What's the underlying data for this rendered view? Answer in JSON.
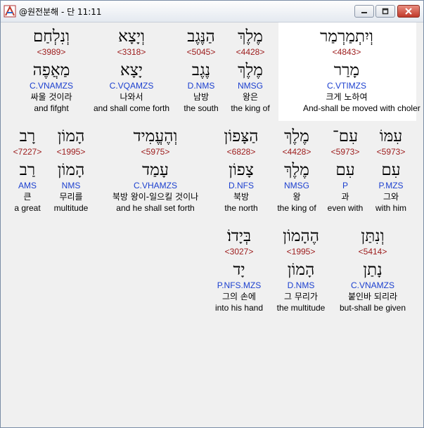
{
  "window": {
    "title": "@원전분해 - 단 11:11"
  },
  "rows": [
    [
      {
        "word": "וְיִתְמַרְמַר",
        "strong": "<4843>",
        "root": "מָרַר",
        "parse": "C.VTIMZS",
        "korean": "크게 노하여",
        "english": "And-shall be moved with choler",
        "highlight": true
      },
      {
        "word": "מֶלֶךְ",
        "strong": "<4428>",
        "root": "מֶלֶךְ",
        "parse": "NMSG",
        "korean": "왕은",
        "english": "the king of"
      },
      {
        "word": "הַנֶּגֶב",
        "strong": "<5045>",
        "root": "נֶגֶב",
        "parse": "D.NMS",
        "korean": "남방",
        "english": "the south"
      },
      {
        "word": "וְיָצָא",
        "strong": "<3318>",
        "root": "יָצָא",
        "parse": "C.VQAMZS",
        "korean": "나와서",
        "english": "and shall come forth"
      },
      {
        "word": "וְנִלְחַם",
        "strong": "<3989>",
        "root": "מַאֲפֶה",
        "parse": "C.VNAMZS",
        "korean": "싸울 것이라",
        "english": "and fifght"
      }
    ],
    [
      {
        "word": "עִמּוֹ",
        "strong": "<5973>",
        "root": "עִם",
        "parse": "P.MZS",
        "korean": "그와",
        "english": "with him"
      },
      {
        "word": "עִם־",
        "strong": "<5973>",
        "root": "עִם",
        "parse": "P",
        "korean": "과",
        "english": "even with"
      },
      {
        "word": "מֶלֶךְ",
        "strong": "<4428>",
        "root": "מֶלֶךְ",
        "parse": "NMSG",
        "korean": "왕",
        "english": "the king of"
      },
      {
        "word": "הַצָּפוֹן",
        "strong": "<6828>",
        "root": "צָפוֹן",
        "parse": "D.NFS",
        "korean": "북방",
        "english": "the north"
      },
      {
        "word": "וְהֶעֱמִיד",
        "strong": "<5975>",
        "root": "עָמַד",
        "parse": "C.VHAMZS",
        "korean": "북방 왕이-일으킬 것이나",
        "english": "and he shall set forth"
      },
      {
        "word": "הָמוֹן",
        "strong": "<1995>",
        "root": "הָמוֹן",
        "parse": "NMS",
        "korean": "무리를",
        "english": "multitude"
      },
      {
        "word": "רָב",
        "strong": "<7227>",
        "root": "רַב",
        "parse": "AMS",
        "korean": "큰",
        "english": "a great"
      }
    ],
    [
      {
        "word": "וְנִתַּן",
        "strong": "<5414>",
        "root": "נָתַן",
        "parse": "C.VNAMZS",
        "korean": "붙인바 되리라",
        "english": "but-shall be given"
      },
      {
        "word": "הֶהָמוֹן",
        "strong": "<1995>",
        "root": "הָמוֹן",
        "parse": "D.NMS",
        "korean": "그 무리가",
        "english": "the multitude"
      },
      {
        "word": "בְּיָדוֹ׃",
        "strong": "<3027>",
        "root": "יָד",
        "parse": "P.NFS.MZS",
        "korean": "그의 손에",
        "english": "into his hand"
      }
    ]
  ]
}
